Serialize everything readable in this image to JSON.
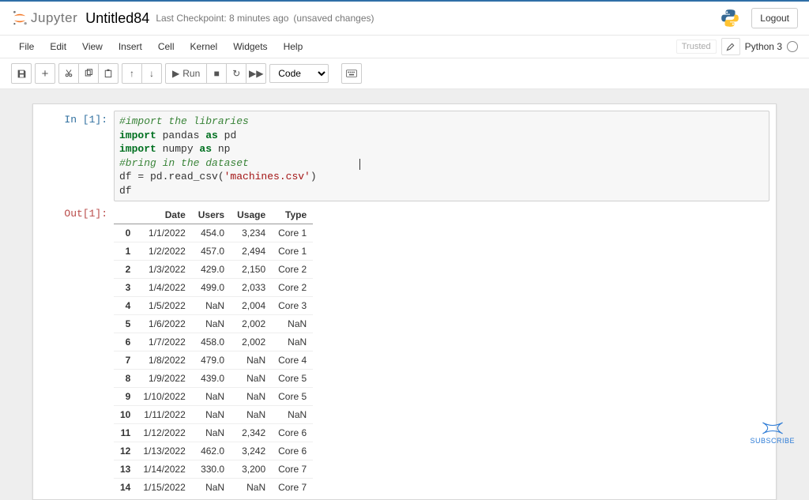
{
  "header": {
    "brand": "Jupyter",
    "title": "Untitled84",
    "checkpoint_prefix": "Last Checkpoint: ",
    "checkpoint_time": "8 minutes ago",
    "unsaved": "(unsaved changes)",
    "logout": "Logout"
  },
  "menubar": {
    "items": [
      "File",
      "Edit",
      "View",
      "Insert",
      "Cell",
      "Kernel",
      "Widgets",
      "Help"
    ],
    "trusted": "Trusted",
    "kernel": "Python 3"
  },
  "toolbar": {
    "run_label": "Run",
    "cell_type": "Code"
  },
  "cells": {
    "in_prompt": "In [1]:",
    "out_prompt": "Out[1]:"
  },
  "code": {
    "l1": "#import the libraries",
    "l2a": "import",
    "l2b": " pandas ",
    "l2c": "as",
    "l2d": " pd",
    "l3a": "import",
    "l3b": " numpy ",
    "l3c": "as",
    "l3d": " np",
    "l4": "#bring in the dataset",
    "l5a": "df = pd.read_csv(",
    "l5b": "'machines.csv'",
    "l5c": ")",
    "l6": "df"
  },
  "df": {
    "columns": [
      "Date",
      "Users",
      "Usage",
      "Type"
    ],
    "rows": [
      {
        "idx": "0",
        "Date": "1/1/2022",
        "Users": "454.0",
        "Usage": "3,234",
        "Type": "Core 1"
      },
      {
        "idx": "1",
        "Date": "1/2/2022",
        "Users": "457.0",
        "Usage": "2,494",
        "Type": "Core 1"
      },
      {
        "idx": "2",
        "Date": "1/3/2022",
        "Users": "429.0",
        "Usage": "2,150",
        "Type": "Core 2"
      },
      {
        "idx": "3",
        "Date": "1/4/2022",
        "Users": "499.0",
        "Usage": "2,033",
        "Type": "Core 2"
      },
      {
        "idx": "4",
        "Date": "1/5/2022",
        "Users": "NaN",
        "Usage": "2,004",
        "Type": "Core 3"
      },
      {
        "idx": "5",
        "Date": "1/6/2022",
        "Users": "NaN",
        "Usage": "2,002",
        "Type": "NaN"
      },
      {
        "idx": "6",
        "Date": "1/7/2022",
        "Users": "458.0",
        "Usage": "2,002",
        "Type": "NaN"
      },
      {
        "idx": "7",
        "Date": "1/8/2022",
        "Users": "479.0",
        "Usage": "NaN",
        "Type": "Core 4"
      },
      {
        "idx": "8",
        "Date": "1/9/2022",
        "Users": "439.0",
        "Usage": "NaN",
        "Type": "Core 5"
      },
      {
        "idx": "9",
        "Date": "1/10/2022",
        "Users": "NaN",
        "Usage": "NaN",
        "Type": "Core 5"
      },
      {
        "idx": "10",
        "Date": "1/11/2022",
        "Users": "NaN",
        "Usage": "NaN",
        "Type": "NaN"
      },
      {
        "idx": "11",
        "Date": "1/12/2022",
        "Users": "NaN",
        "Usage": "2,342",
        "Type": "Core 6"
      },
      {
        "idx": "12",
        "Date": "1/13/2022",
        "Users": "462.0",
        "Usage": "3,242",
        "Type": "Core 6"
      },
      {
        "idx": "13",
        "Date": "1/14/2022",
        "Users": "330.0",
        "Usage": "3,200",
        "Type": "Core 7"
      },
      {
        "idx": "14",
        "Date": "1/15/2022",
        "Users": "NaN",
        "Usage": "NaN",
        "Type": "Core 7"
      }
    ]
  },
  "badge": {
    "subscribe": "SUBSCRIBE"
  }
}
